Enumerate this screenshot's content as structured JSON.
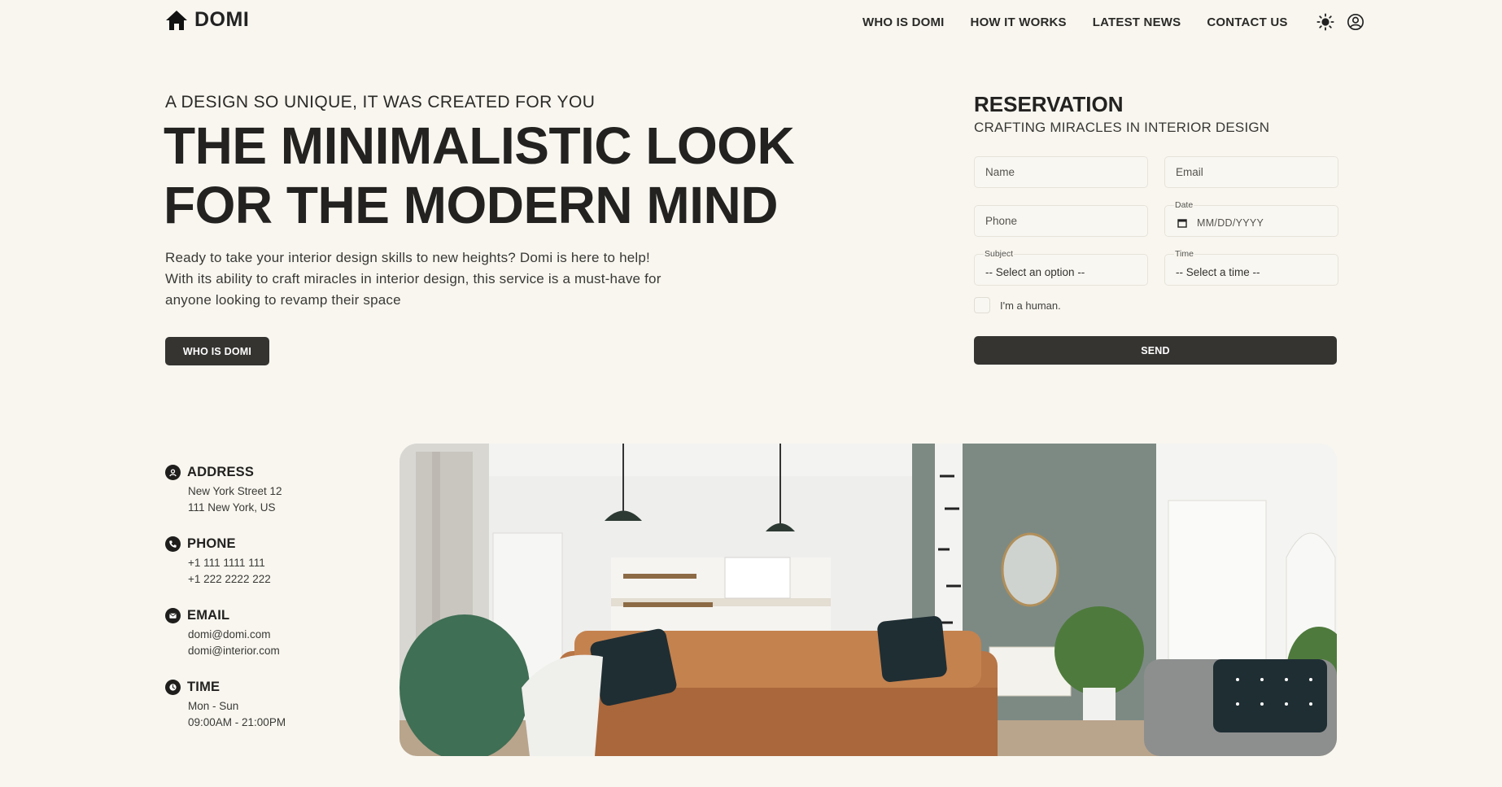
{
  "header": {
    "logo_text": "DOMI",
    "nav": [
      "WHO IS DOMI",
      "HOW IT WORKS",
      "LATEST NEWS",
      "CONTACT US"
    ],
    "icons": [
      "house-icon",
      "sun-icon",
      "user-icon"
    ]
  },
  "hero": {
    "subtitle": "A DESIGN SO UNIQUE, IT WAS CREATED FOR YOU",
    "title_line1": "THE MINIMALISTIC LOOK",
    "title_line2": "FOR THE MODERN MIND",
    "desc_line1": "Ready to take your interior design skills to new heights? Domi is here to help!",
    "desc_line2": "With its ability to craft miracles in interior design, this service is a must-have for",
    "desc_line3": "anyone looking to revamp their space",
    "button": "WHO IS DOMI"
  },
  "reservation": {
    "title": "RESERVATION",
    "subtitle": "CRAFTING MIRACLES IN INTERIOR DESIGN",
    "name_placeholder": "Name",
    "email_placeholder": "Email",
    "phone_placeholder": "Phone",
    "date_label": "Date",
    "date_placeholder": "MM/DD/YYYY",
    "subject_label": "Subject",
    "subject_value": "-- Select an option --",
    "time_label": "Time",
    "time_value": "-- Select a time --",
    "checkbox_label": "I'm a human.",
    "send_button": "SEND"
  },
  "contact": {
    "address": {
      "title": "ADDRESS",
      "line1": "New York Street 12",
      "line2": "111 New York, US"
    },
    "phone": {
      "title": "PHONE",
      "line1": "+1 111 1111 111",
      "line2": "+1 222 2222 222"
    },
    "email": {
      "title": "EMAIL",
      "line1": "domi@domi.com",
      "line2": "domi@interior.com"
    },
    "time": {
      "title": "TIME",
      "line1": "Mon - Sun",
      "line2": "09:00AM - 21:00PM"
    }
  },
  "colors": {
    "background": "#f8f6ef",
    "button": "#363431",
    "text": "#2b2a27"
  }
}
